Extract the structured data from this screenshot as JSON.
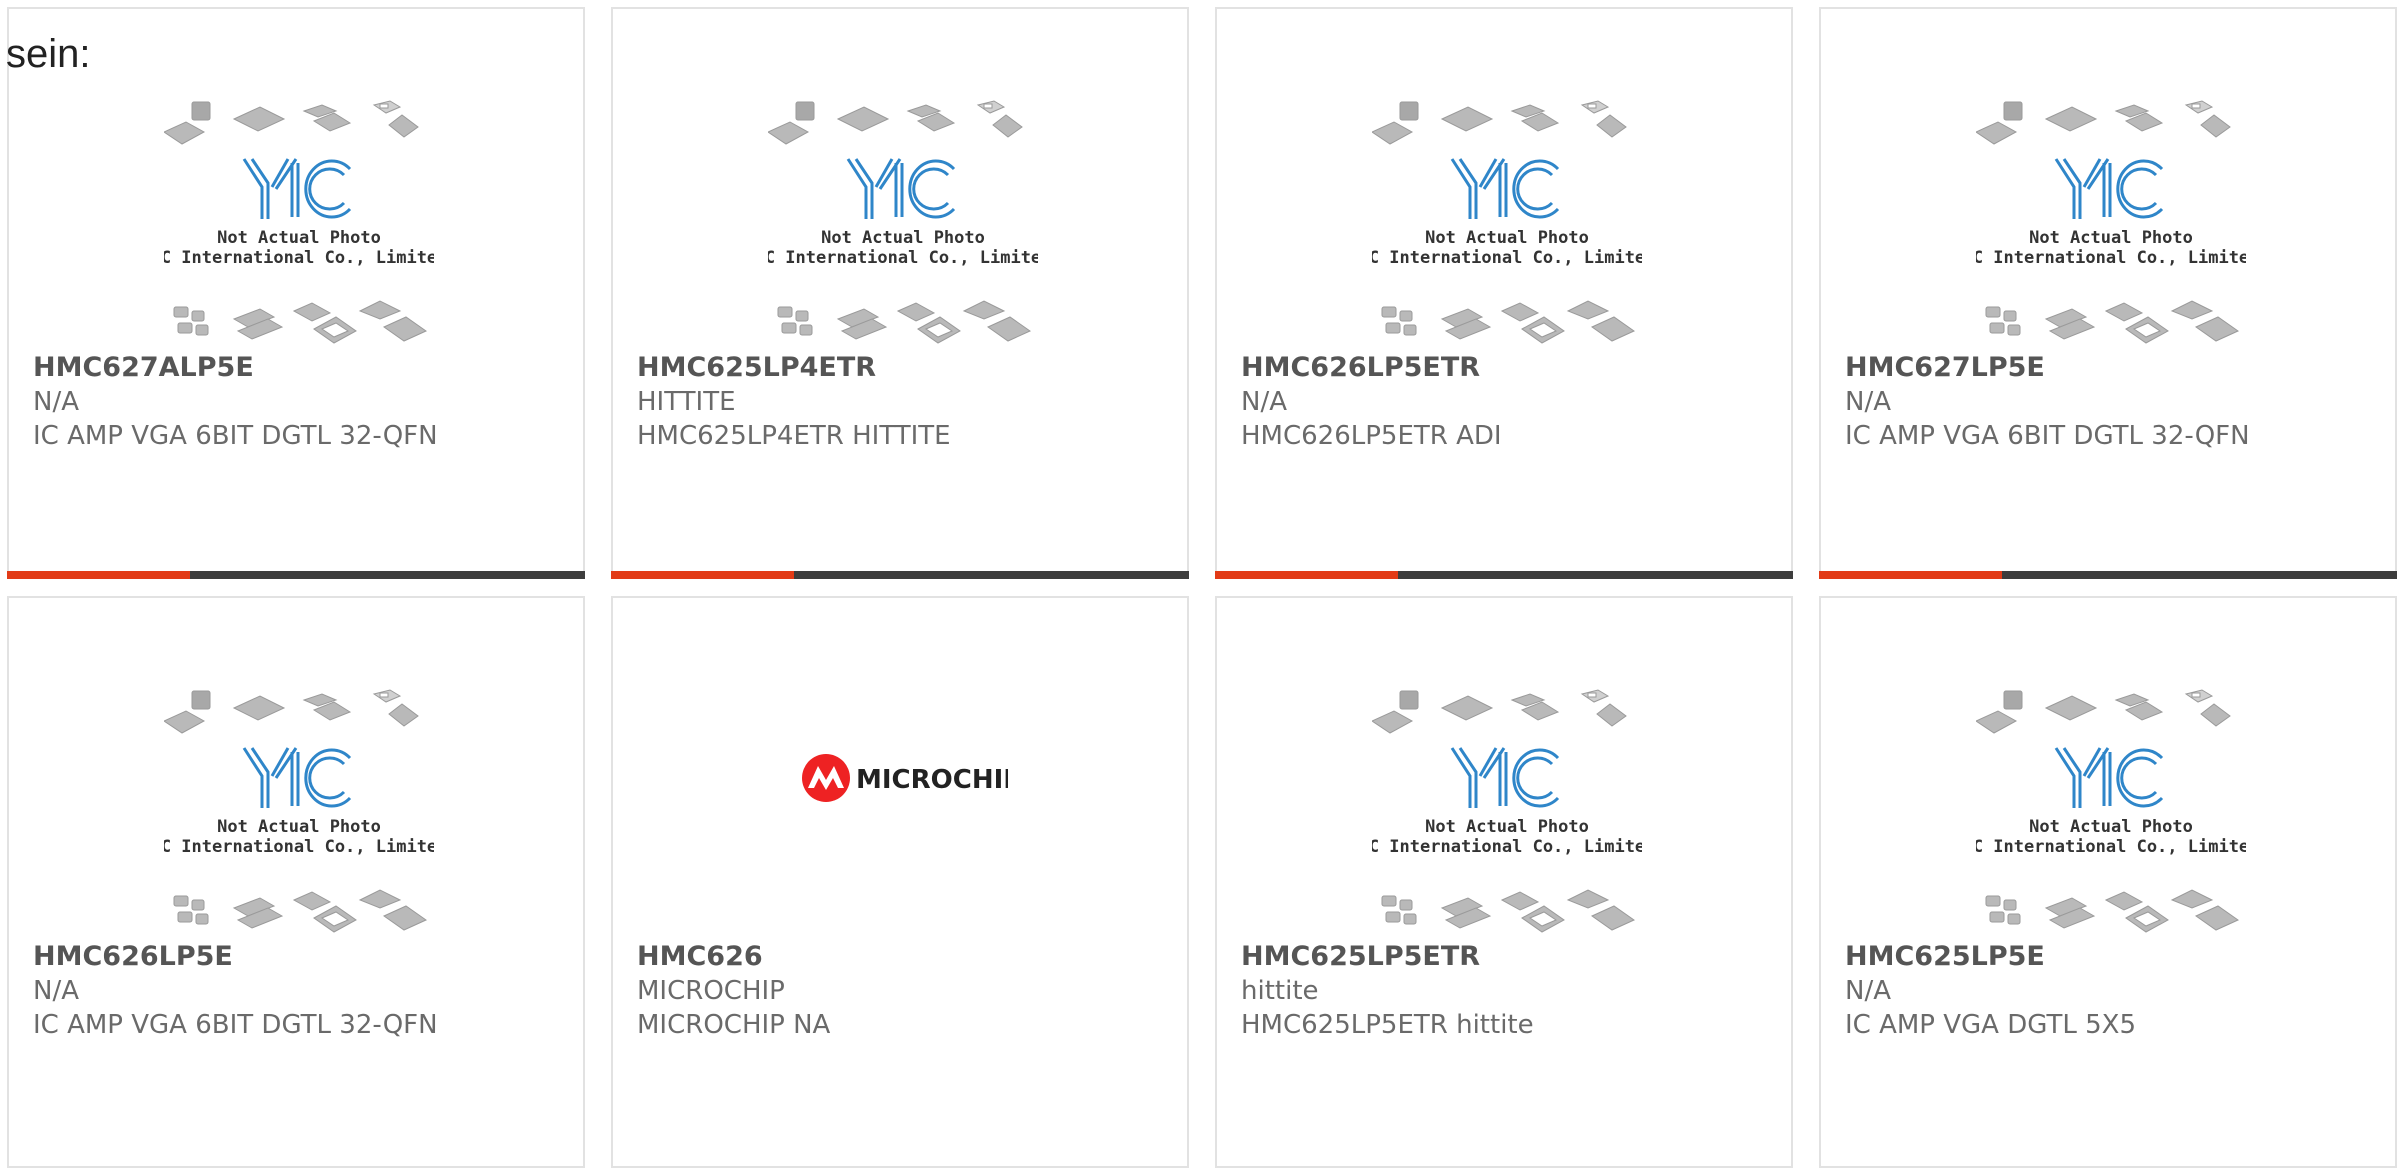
{
  "lead_text": "sein:",
  "placeholder_photo": {
    "line1": "Not Actual Photo",
    "line2": "YIC International Co., Limited.",
    "logo_text": "YIC"
  },
  "microchip_logo_text": "MICROCHIP",
  "colors": {
    "accent": "#e23b17",
    "bar": "#3d3d3d",
    "yic_blue": "#2f86c9"
  },
  "products": [
    {
      "part": "HMC627ALP5E",
      "maker": "N/A",
      "desc": "IC AMP VGA 6BIT DGTL 32-QFN",
      "image": "yic-placeholder"
    },
    {
      "part": "HMC625LP4ETR",
      "maker": "HITTITE",
      "desc": "HMC625LP4ETR HITTITE",
      "image": "yic-placeholder"
    },
    {
      "part": "HMC626LP5ETR",
      "maker": "N/A",
      "desc": "HMC626LP5ETR ADI",
      "image": "yic-placeholder"
    },
    {
      "part": "HMC627LP5E",
      "maker": "N/A",
      "desc": "IC AMP VGA 6BIT DGTL 32-QFN",
      "image": "yic-placeholder"
    },
    {
      "part": "HMC626LP5E",
      "maker": "N/A",
      "desc": "IC AMP VGA 6BIT DGTL 32-QFN",
      "image": "yic-placeholder"
    },
    {
      "part": "HMC626",
      "maker": "MICROCHIP",
      "desc": "MICROCHIP NA",
      "image": "microchip-logo"
    },
    {
      "part": "HMC625LP5ETR",
      "maker": "hittite",
      "desc": "HMC625LP5ETR hittite",
      "image": "yic-placeholder"
    },
    {
      "part": "HMC625LP5E",
      "maker": "N/A",
      "desc": "IC AMP VGA DGTL 5X5",
      "image": "yic-placeholder"
    }
  ]
}
